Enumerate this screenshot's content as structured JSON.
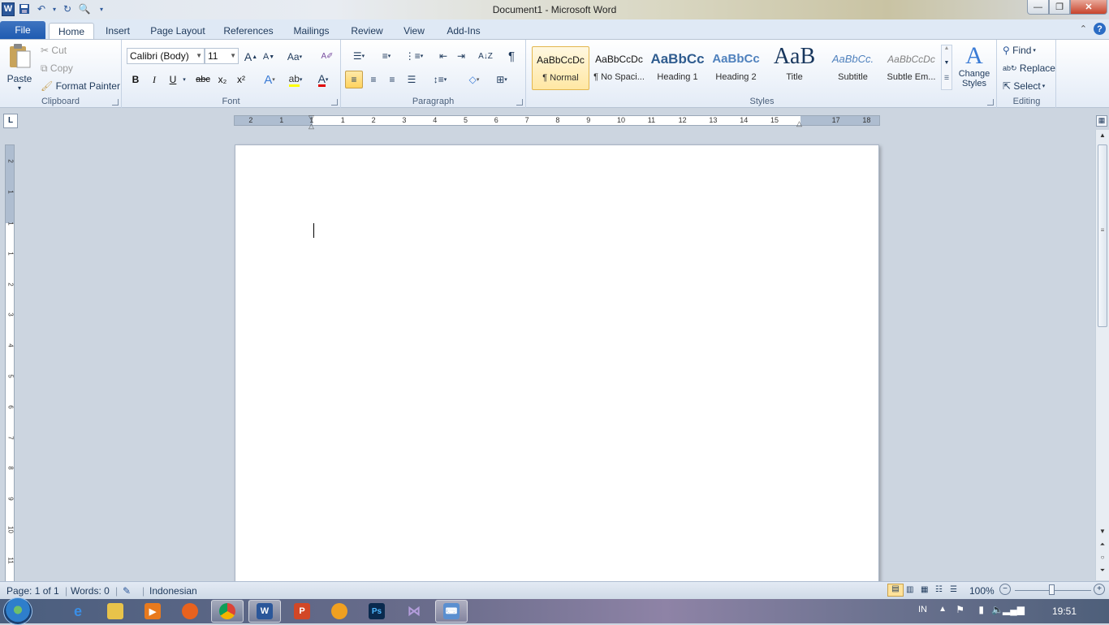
{
  "window": {
    "title": "Document1  -  Microsoft Word"
  },
  "qat": {
    "logo": "W"
  },
  "tabs": [
    "File",
    "Home",
    "Insert",
    "Page Layout",
    "References",
    "Mailings",
    "Review",
    "View",
    "Add-Ins"
  ],
  "clipboard": {
    "label": "Clipboard",
    "paste": "Paste",
    "cut": "Cut",
    "copy": "Copy",
    "format_painter": "Format Painter"
  },
  "font": {
    "label": "Font",
    "name": "Calibri (Body)",
    "size": "11",
    "aa": "Aa",
    "bold": "B",
    "italic": "I",
    "underline": "U",
    "strike": "abc",
    "sub": "x₂",
    "sup": "x²"
  },
  "paragraph": {
    "label": "Paragraph",
    "pilcrow": "¶"
  },
  "styles": {
    "label": "Styles",
    "items": [
      {
        "preview": "AaBbCcDc",
        "name": "¶ Normal"
      },
      {
        "preview": "AaBbCcDc",
        "name": "¶ No Spaci..."
      },
      {
        "preview": "AaBbCc",
        "name": "Heading 1"
      },
      {
        "preview": "AaBbCc",
        "name": "Heading 2"
      },
      {
        "preview": "AaB",
        "name": "Title"
      },
      {
        "preview": "AaBbCc.",
        "name": "Subtitle"
      },
      {
        "preview": "AaBbCcDc",
        "name": "Subtle Em..."
      }
    ],
    "change_styles": "Change Styles"
  },
  "editing": {
    "label": "Editing",
    "find": "Find",
    "replace": "Replace",
    "select": "Select"
  },
  "ruler": {
    "numbers": [
      "2",
      "1",
      "1",
      "1",
      "2",
      "3",
      "4",
      "5",
      "6",
      "7",
      "8",
      "9",
      "10",
      "11",
      "12",
      "13",
      "14",
      "15",
      "",
      "17",
      "18"
    ]
  },
  "vruler": {
    "numbers": [
      "2",
      "1",
      "1",
      "1",
      "2",
      "3",
      "4",
      "5",
      "6",
      "7",
      "8",
      "9",
      "10",
      "11"
    ]
  },
  "status": {
    "page": "Page: 1 of 1",
    "words": "Words: 0",
    "language": "Indonesian",
    "zoom": "100%"
  },
  "taskbar": {
    "time": "19:51",
    "lang": "IN"
  },
  "colors": {
    "accent": "#2b579a",
    "file_tab": "#1f5bb1"
  }
}
